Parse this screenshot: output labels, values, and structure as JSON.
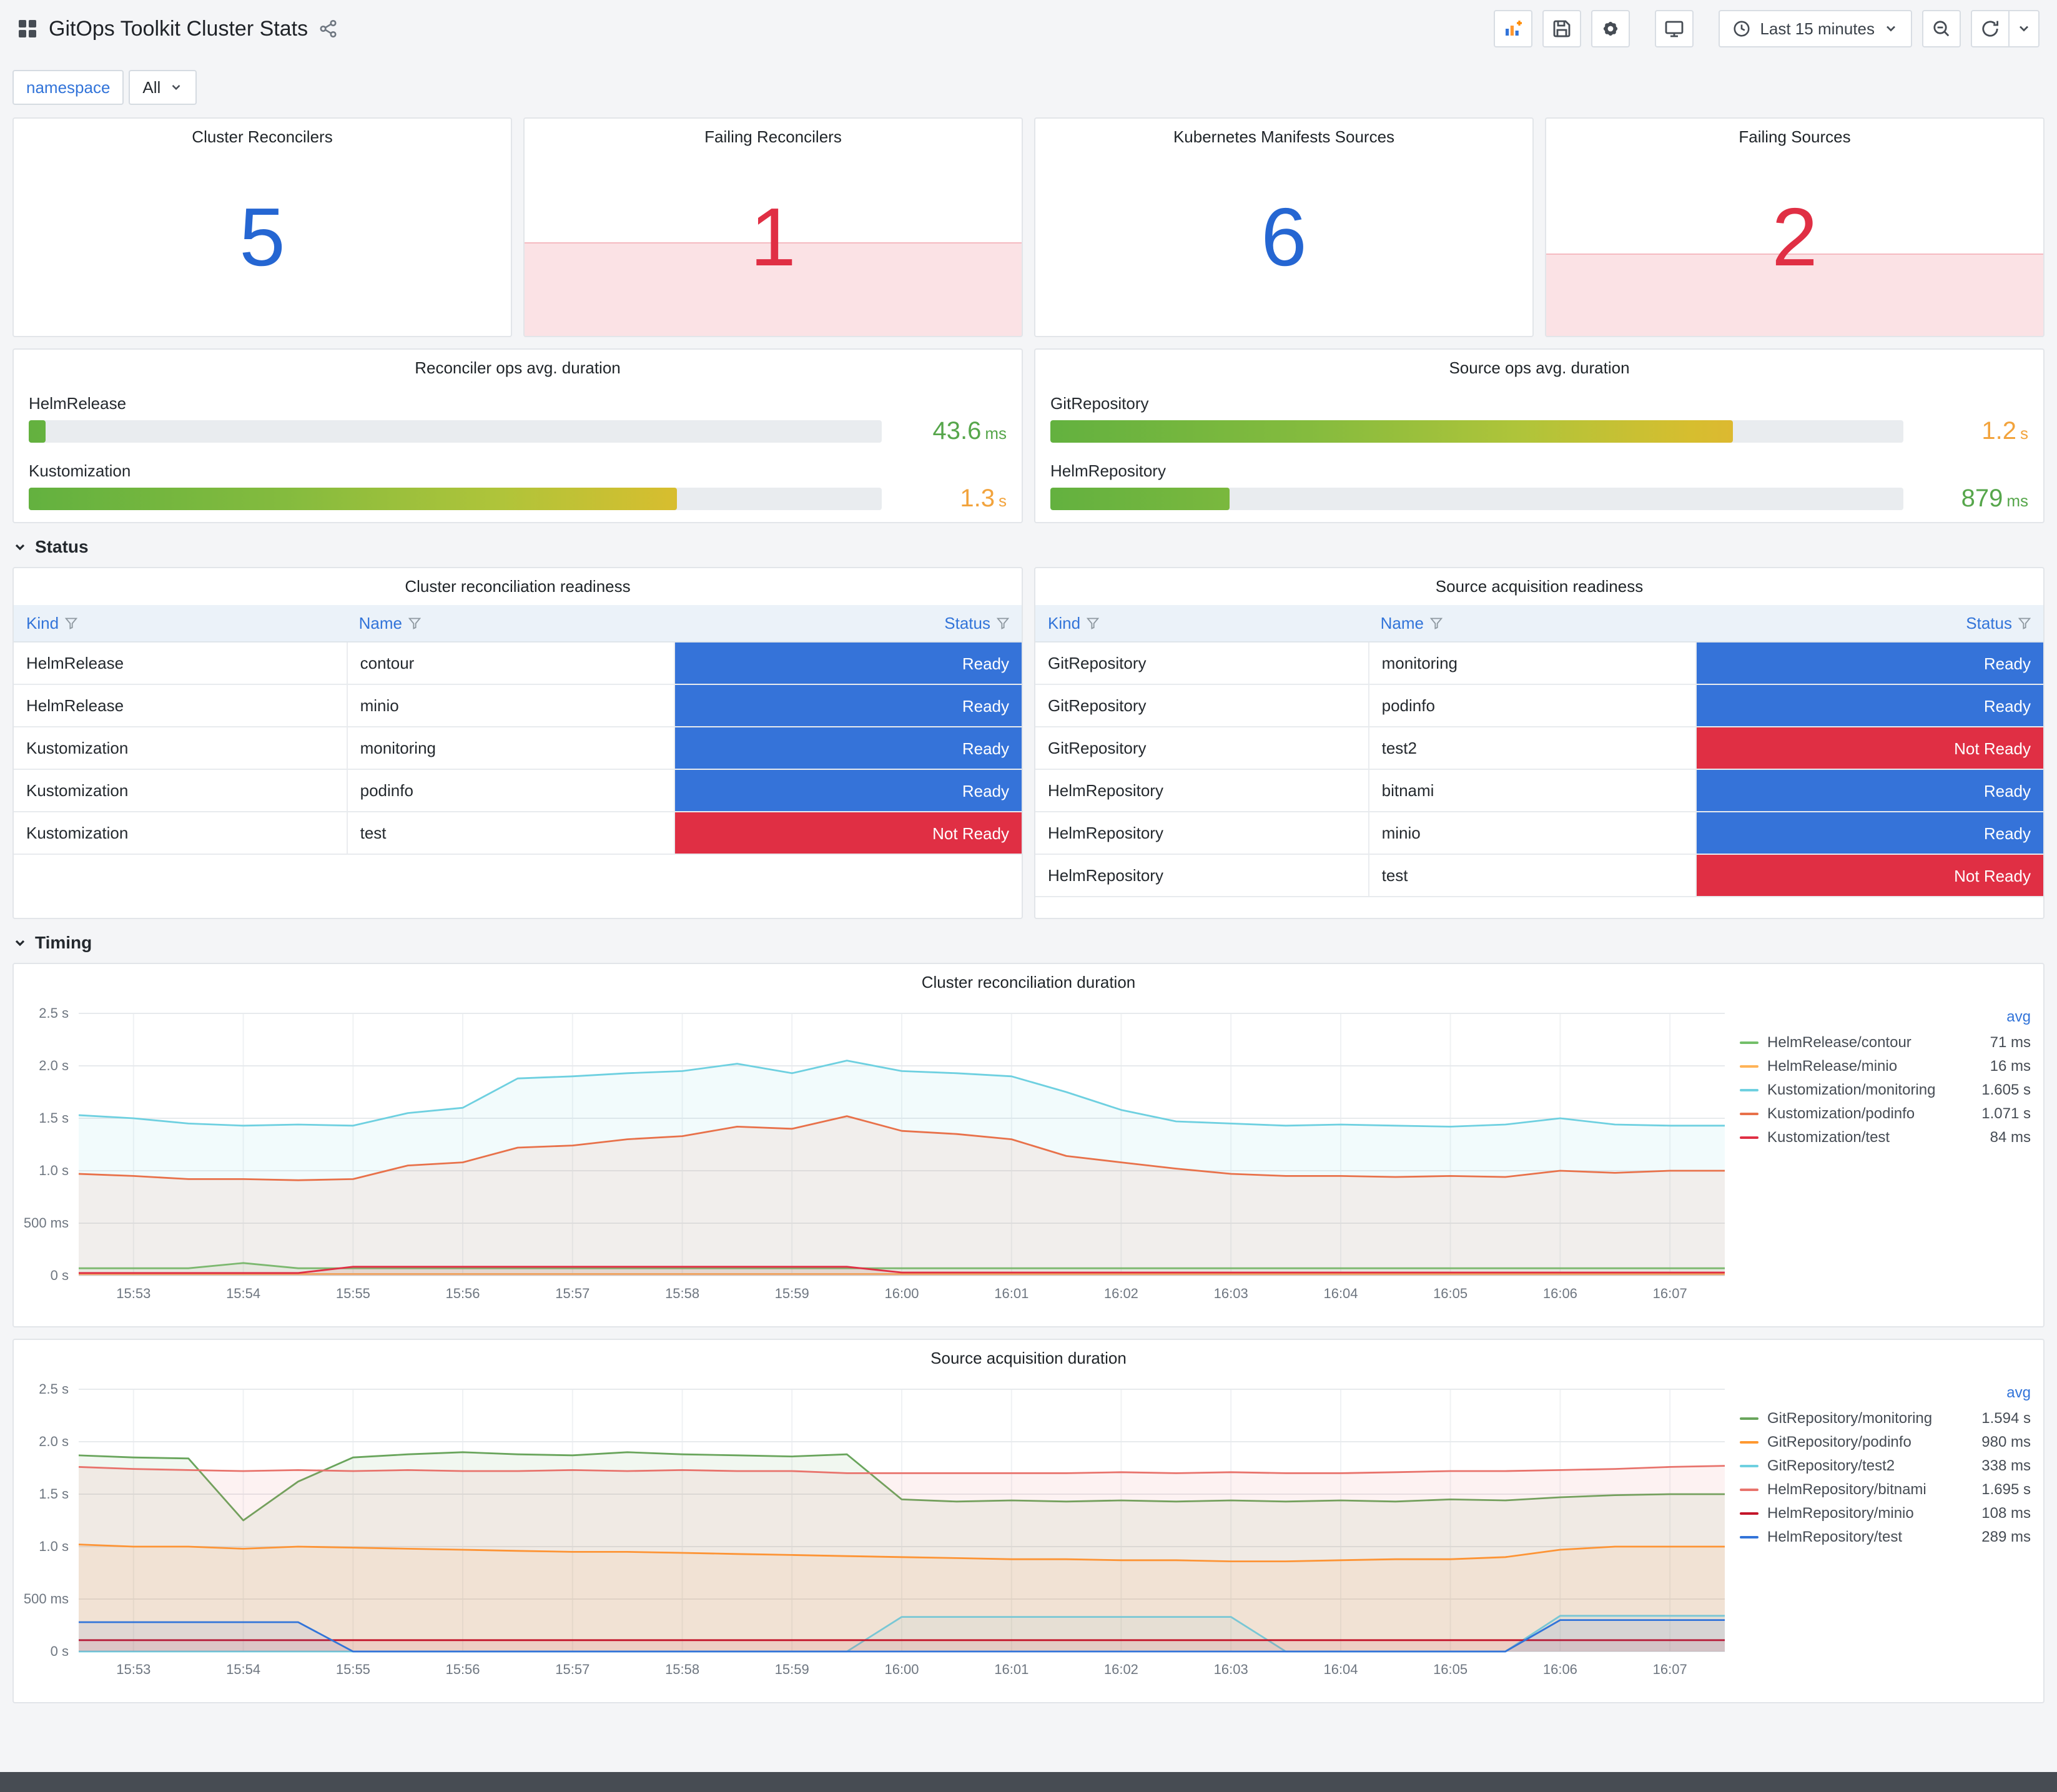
{
  "header": {
    "title": "GitOps Toolkit Cluster Stats",
    "time_range": "Last 15 minutes"
  },
  "variables": {
    "label": "namespace",
    "value": "All"
  },
  "stats": [
    {
      "title": "Cluster Reconcilers",
      "value": "5",
      "state": "ok"
    },
    {
      "title": "Failing Reconcilers",
      "value": "1",
      "state": "alert",
      "band_pct": 43
    },
    {
      "title": "Kubernetes Manifests Sources",
      "value": "6",
      "state": "ok"
    },
    {
      "title": "Failing Sources",
      "value": "2",
      "state": "alert",
      "band_pct": 38
    }
  ],
  "gauge_panels": [
    {
      "title": "Reconciler ops avg. duration",
      "bars": [
        {
          "label": "HelmRelease",
          "value": "43.6",
          "unit": "ms",
          "pct": 2,
          "value_color": "#56A64B"
        },
        {
          "label": "Kustomization",
          "value": "1.3",
          "unit": "s",
          "pct": 76,
          "value_color": "#F2A33C"
        }
      ]
    },
    {
      "title": "Source ops avg. duration",
      "bars": [
        {
          "label": "GitRepository",
          "value": "1.2",
          "unit": "s",
          "pct": 80,
          "value_color": "#F2A33C"
        },
        {
          "label": "HelmRepository",
          "value": "879",
          "unit": "ms",
          "pct": 21,
          "value_color": "#56A64B"
        }
      ]
    }
  ],
  "sections": {
    "status": "Status",
    "timing": "Timing"
  },
  "tables": [
    {
      "title": "Cluster reconciliation readiness",
      "columns": [
        "Kind",
        "Name",
        "Status"
      ],
      "rows": [
        {
          "kind": "HelmRelease",
          "name": "contour",
          "status": "Ready",
          "ok": true
        },
        {
          "kind": "HelmRelease",
          "name": "minio",
          "status": "Ready",
          "ok": true
        },
        {
          "kind": "Kustomization",
          "name": "monitoring",
          "status": "Ready",
          "ok": true
        },
        {
          "kind": "Kustomization",
          "name": "podinfo",
          "status": "Ready",
          "ok": true
        },
        {
          "kind": "Kustomization",
          "name": "test",
          "status": "Not Ready",
          "ok": false
        }
      ]
    },
    {
      "title": "Source acquisition readiness",
      "columns": [
        "Kind",
        "Name",
        "Status"
      ],
      "rows": [
        {
          "kind": "GitRepository",
          "name": "monitoring",
          "status": "Ready",
          "ok": true
        },
        {
          "kind": "GitRepository",
          "name": "podinfo",
          "status": "Ready",
          "ok": true
        },
        {
          "kind": "GitRepository",
          "name": "test2",
          "status": "Not Ready",
          "ok": false
        },
        {
          "kind": "HelmRepository",
          "name": "bitnami",
          "status": "Ready",
          "ok": true
        },
        {
          "kind": "HelmRepository",
          "name": "minio",
          "status": "Ready",
          "ok": true
        },
        {
          "kind": "HelmRepository",
          "name": "test",
          "status": "Not Ready",
          "ok": false
        }
      ]
    }
  ],
  "chart_data": [
    {
      "type": "line",
      "title": "Cluster reconciliation duration",
      "legend_header": "avg",
      "ylim": [
        0,
        2.5
      ],
      "x_count": 31,
      "y_ticks": [
        {
          "v": 0,
          "label": "0 s"
        },
        {
          "v": 0.5,
          "label": "500 ms"
        },
        {
          "v": 1,
          "label": "1.0 s"
        },
        {
          "v": 1.5,
          "label": "1.5 s"
        },
        {
          "v": 2,
          "label": "2.0 s"
        },
        {
          "v": 2.5,
          "label": "2.5 s"
        }
      ],
      "x_ticks": [
        {
          "i": 1,
          "label": "15:53"
        },
        {
          "i": 3,
          "label": "15:54"
        },
        {
          "i": 5,
          "label": "15:55"
        },
        {
          "i": 7,
          "label": "15:56"
        },
        {
          "i": 9,
          "label": "15:57"
        },
        {
          "i": 11,
          "label": "15:58"
        },
        {
          "i": 13,
          "label": "15:59"
        },
        {
          "i": 15,
          "label": "16:00"
        },
        {
          "i": 17,
          "label": "16:01"
        },
        {
          "i": 19,
          "label": "16:02"
        },
        {
          "i": 21,
          "label": "16:03"
        },
        {
          "i": 23,
          "label": "16:04"
        },
        {
          "i": 25,
          "label": "16:05"
        },
        {
          "i": 27,
          "label": "16:06"
        },
        {
          "i": 29,
          "label": "16:07"
        }
      ],
      "series": [
        {
          "name": "HelmRelease/contour",
          "color": "#73BF69",
          "avg": "71 ms",
          "values": [
            0.07,
            0.07,
            0.07,
            0.12,
            0.07,
            0.07,
            0.07,
            0.07,
            0.07,
            0.07,
            0.07,
            0.07,
            0.07,
            0.07,
            0.07,
            0.07,
            0.07,
            0.07,
            0.07,
            0.07,
            0.07,
            0.07,
            0.07,
            0.07,
            0.07,
            0.07,
            0.07,
            0.07,
            0.07,
            0.07,
            0.07
          ]
        },
        {
          "name": "HelmRelease/minio",
          "color": "#FFB357",
          "avg": "16 ms",
          "values": [
            0.016,
            0.016,
            0.016,
            0.016,
            0.016,
            0.016,
            0.016,
            0.016,
            0.016,
            0.016,
            0.016,
            0.016,
            0.016,
            0.016,
            0.016,
            0.016,
            0.016,
            0.016,
            0.016,
            0.016,
            0.016,
            0.016,
            0.016,
            0.016,
            0.016,
            0.016,
            0.016,
            0.016,
            0.016,
            0.016,
            0.016
          ]
        },
        {
          "name": "Kustomization/monitoring",
          "color": "#6ED0E0",
          "avg": "1.605 s",
          "values": [
            1.53,
            1.5,
            1.45,
            1.43,
            1.44,
            1.43,
            1.55,
            1.6,
            1.88,
            1.9,
            1.93,
            1.95,
            2.02,
            1.93,
            2.05,
            1.95,
            1.93,
            1.9,
            1.75,
            1.58,
            1.47,
            1.45,
            1.43,
            1.44,
            1.43,
            1.42,
            1.44,
            1.5,
            1.44,
            1.43,
            1.43
          ]
        },
        {
          "name": "Kustomization/podinfo",
          "color": "#E8714A",
          "avg": "1.071 s",
          "values": [
            0.97,
            0.95,
            0.92,
            0.92,
            0.91,
            0.92,
            1.05,
            1.08,
            1.22,
            1.24,
            1.3,
            1.33,
            1.42,
            1.4,
            1.52,
            1.38,
            1.35,
            1.3,
            1.14,
            1.08,
            1.02,
            0.97,
            0.95,
            0.95,
            0.94,
            0.95,
            0.94,
            1.0,
            0.98,
            1.0,
            1.0
          ]
        },
        {
          "name": "Kustomization/test",
          "color": "#E02F44",
          "avg": "84 ms",
          "values": [
            0.025,
            0.025,
            0.025,
            0.025,
            0.025,
            0.085,
            0.085,
            0.085,
            0.085,
            0.085,
            0.085,
            0.085,
            0.085,
            0.085,
            0.085,
            0.03,
            0.03,
            0.03,
            0.03,
            0.03,
            0.03,
            0.03,
            0.03,
            0.03,
            0.03,
            0.03,
            0.03,
            0.03,
            0.03,
            0.03,
            0.03
          ]
        }
      ]
    },
    {
      "type": "line",
      "title": "Source acquisition duration",
      "legend_header": "avg",
      "ylim": [
        0,
        2.5
      ],
      "x_count": 31,
      "y_ticks": [
        {
          "v": 0,
          "label": "0 s"
        },
        {
          "v": 0.5,
          "label": "500 ms"
        },
        {
          "v": 1,
          "label": "1.0 s"
        },
        {
          "v": 1.5,
          "label": "1.5 s"
        },
        {
          "v": 2,
          "label": "2.0 s"
        },
        {
          "v": 2.5,
          "label": "2.5 s"
        }
      ],
      "x_ticks": [
        {
          "i": 1,
          "label": "15:53"
        },
        {
          "i": 3,
          "label": "15:54"
        },
        {
          "i": 5,
          "label": "15:55"
        },
        {
          "i": 7,
          "label": "15:56"
        },
        {
          "i": 9,
          "label": "15:57"
        },
        {
          "i": 11,
          "label": "15:58"
        },
        {
          "i": 13,
          "label": "15:59"
        },
        {
          "i": 15,
          "label": "16:00"
        },
        {
          "i": 17,
          "label": "16:01"
        },
        {
          "i": 19,
          "label": "16:02"
        },
        {
          "i": 21,
          "label": "16:03"
        },
        {
          "i": 23,
          "label": "16:04"
        },
        {
          "i": 25,
          "label": "16:05"
        },
        {
          "i": 27,
          "label": "16:06"
        },
        {
          "i": 29,
          "label": "16:07"
        }
      ],
      "series": [
        {
          "name": "GitRepository/monitoring",
          "color": "#69A55C",
          "avg": "1.594 s",
          "values": [
            1.87,
            1.85,
            1.84,
            1.25,
            1.62,
            1.85,
            1.88,
            1.9,
            1.88,
            1.87,
            1.9,
            1.88,
            1.87,
            1.86,
            1.88,
            1.45,
            1.43,
            1.44,
            1.43,
            1.44,
            1.43,
            1.44,
            1.43,
            1.44,
            1.43,
            1.45,
            1.44,
            1.47,
            1.49,
            1.5,
            1.5
          ]
        },
        {
          "name": "GitRepository/podinfo",
          "color": "#FF9830",
          "avg": "980 ms",
          "values": [
            1.02,
            1.0,
            1.0,
            0.98,
            1.0,
            0.99,
            0.98,
            0.97,
            0.96,
            0.95,
            0.95,
            0.94,
            0.93,
            0.92,
            0.91,
            0.9,
            0.89,
            0.88,
            0.88,
            0.87,
            0.87,
            0.86,
            0.86,
            0.87,
            0.88,
            0.88,
            0.9,
            0.97,
            1.0,
            1.0,
            1.0
          ]
        },
        {
          "name": "GitRepository/test2",
          "color": "#6ED0E0",
          "avg": "338 ms",
          "values": [
            0,
            0,
            0,
            0,
            0,
            0,
            0,
            0,
            0,
            0,
            0,
            0,
            0,
            0,
            0,
            0.33,
            0.33,
            0.33,
            0.33,
            0.33,
            0.33,
            0.33,
            0,
            0,
            0,
            0,
            0,
            0.34,
            0.34,
            0.34,
            0.34
          ]
        },
        {
          "name": "HelmRepository/bitnami",
          "color": "#E8736C",
          "avg": "1.695 s",
          "values": [
            1.76,
            1.74,
            1.73,
            1.72,
            1.73,
            1.72,
            1.73,
            1.72,
            1.72,
            1.73,
            1.72,
            1.73,
            1.72,
            1.72,
            1.7,
            1.7,
            1.7,
            1.7,
            1.7,
            1.71,
            1.7,
            1.71,
            1.7,
            1.7,
            1.71,
            1.72,
            1.72,
            1.73,
            1.74,
            1.76,
            1.77
          ]
        },
        {
          "name": "HelmRepository/minio",
          "color": "#C4162A",
          "avg": "108 ms",
          "values": [
            0.108,
            0.108,
            0.108,
            0.108,
            0.108,
            0.108,
            0.108,
            0.108,
            0.108,
            0.108,
            0.108,
            0.108,
            0.108,
            0.108,
            0.108,
            0.108,
            0.108,
            0.108,
            0.108,
            0.108,
            0.108,
            0.108,
            0.108,
            0.108,
            0.108,
            0.108,
            0.108,
            0.108,
            0.108,
            0.108,
            0.108
          ]
        },
        {
          "name": "HelmRepository/test",
          "color": "#3274D9",
          "avg": "289 ms",
          "values": [
            0.28,
            0.28,
            0.28,
            0.28,
            0.28,
            0,
            0,
            0,
            0,
            0,
            0,
            0,
            0,
            0,
            0,
            0,
            0,
            0,
            0,
            0,
            0,
            0,
            0,
            0,
            0,
            0,
            0,
            0.3,
            0.3,
            0.3,
            0.3
          ]
        }
      ]
    }
  ]
}
